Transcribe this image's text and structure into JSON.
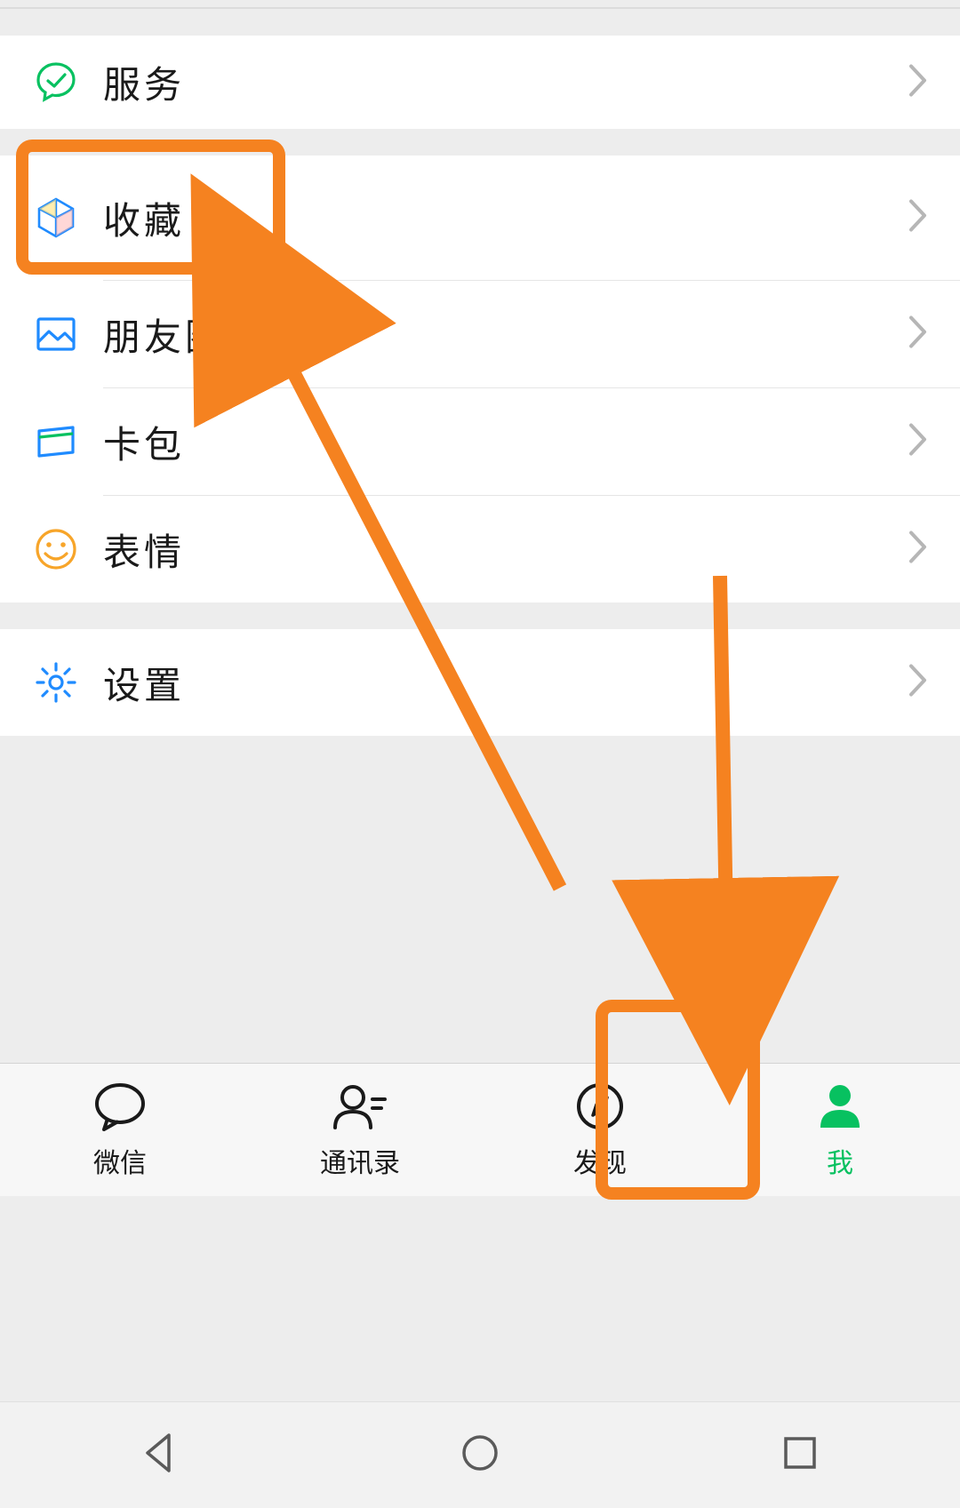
{
  "colors": {
    "accent_green": "#07c160",
    "highlight_orange": "#f58220",
    "icon_blue": "#1f8bff",
    "icon_orange": "#f7a52a",
    "text": "#1a1a1a"
  },
  "section1": {
    "service": "服务"
  },
  "section2": {
    "favorites": "收藏",
    "moments": "朋友圈",
    "cards": "卡包",
    "stickers": "表情"
  },
  "section3": {
    "settings": "设置"
  },
  "tabs": {
    "chat": "微信",
    "contacts": "通讯录",
    "discover": "发现",
    "me": "我"
  }
}
